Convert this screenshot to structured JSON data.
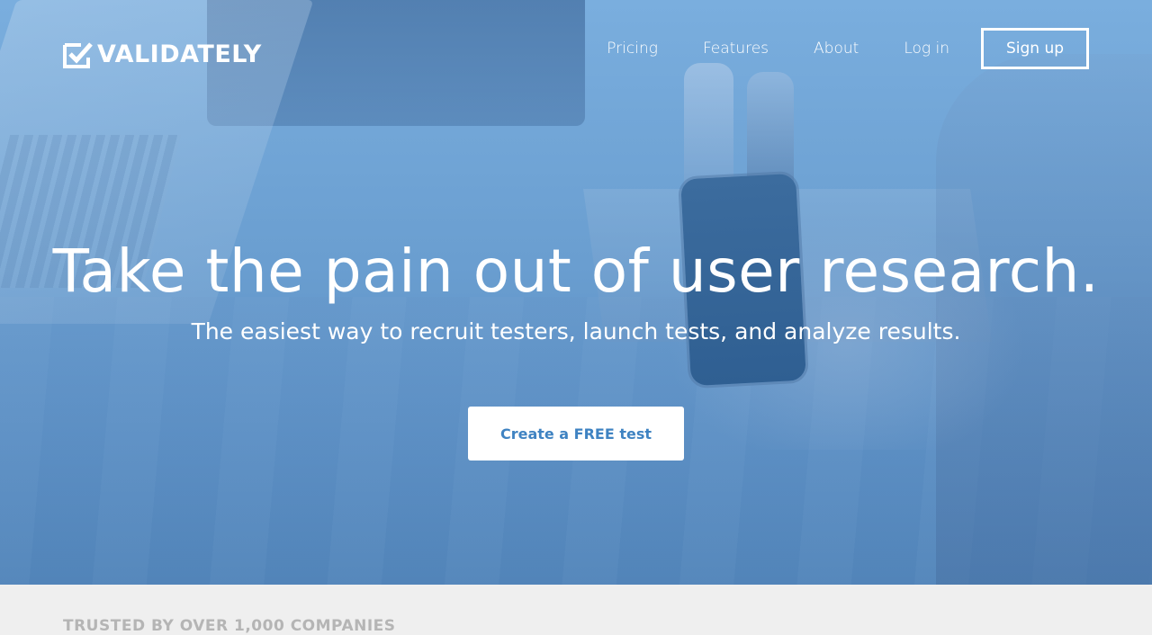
{
  "header": {
    "logo_text": "VALIDATELY",
    "nav": [
      {
        "label": "Pricing"
      },
      {
        "label": "Features"
      },
      {
        "label": "About"
      },
      {
        "label": "Log in"
      }
    ],
    "signup_label": "Sign up"
  },
  "hero": {
    "title": "Take the pain out of user research.",
    "subtitle": "The easiest way to recruit testers, launch tests, and analyze results.",
    "cta_label": "Create a FREE test",
    "overlay_color": "#6a9ed0"
  },
  "trusted": {
    "heading": "TRUSTED BY OVER 1,000 COMPANIES"
  },
  "colors": {
    "accent": "#3f83c2",
    "text_on_hero": "#ffffff",
    "page_bg": "#efefef",
    "muted": "#b5b5b5"
  },
  "icons": {
    "logo": "checkbox-check-icon"
  }
}
